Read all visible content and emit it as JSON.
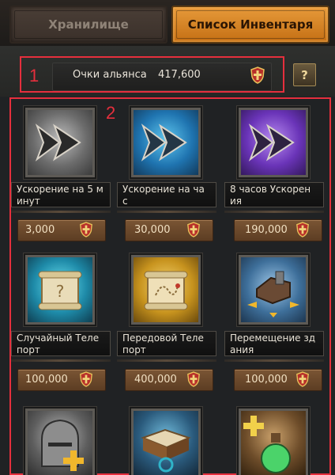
{
  "tabs": [
    {
      "label": "Хранилище",
      "active": false
    },
    {
      "label": "Список Инвентаря",
      "active": true
    }
  ],
  "alliance": {
    "label": "Очки альянса",
    "value": "417,600",
    "help_label": "?",
    "icon": "alliance-shield-icon"
  },
  "annotations": {
    "box1": "1",
    "box2": "2"
  },
  "items": [
    {
      "name": "Ускорение на 5 м\nинут",
      "price": "3,000",
      "icon": "speedup-5min-icon"
    },
    {
      "name": "Ускорение на ча\nс",
      "price": "30,000",
      "icon": "speedup-1h-icon"
    },
    {
      "name": "8 часов Ускорен\nия",
      "price": "190,000",
      "icon": "speedup-8h-icon"
    },
    {
      "name": "Случайный Теле\nпорт",
      "price": "100,000",
      "icon": "random-teleport-scroll-icon"
    },
    {
      "name": "Передовой Теле\nпорт",
      "price": "400,000",
      "icon": "advanced-teleport-scroll-icon"
    },
    {
      "name": "Перемещение зд\nания",
      "price": "100,000",
      "icon": "building-move-icon"
    },
    {
      "name": "",
      "price": "",
      "icon": "knight-helmet-plus-icon"
    },
    {
      "name": "",
      "price": "",
      "icon": "book-icon"
    },
    {
      "name": "",
      "price": "",
      "icon": "potion-plus-icon"
    }
  ],
  "colors": {
    "accent": "#e79a3a",
    "annotation": "#e52f3d",
    "price_plate": "#6b4a2c"
  }
}
